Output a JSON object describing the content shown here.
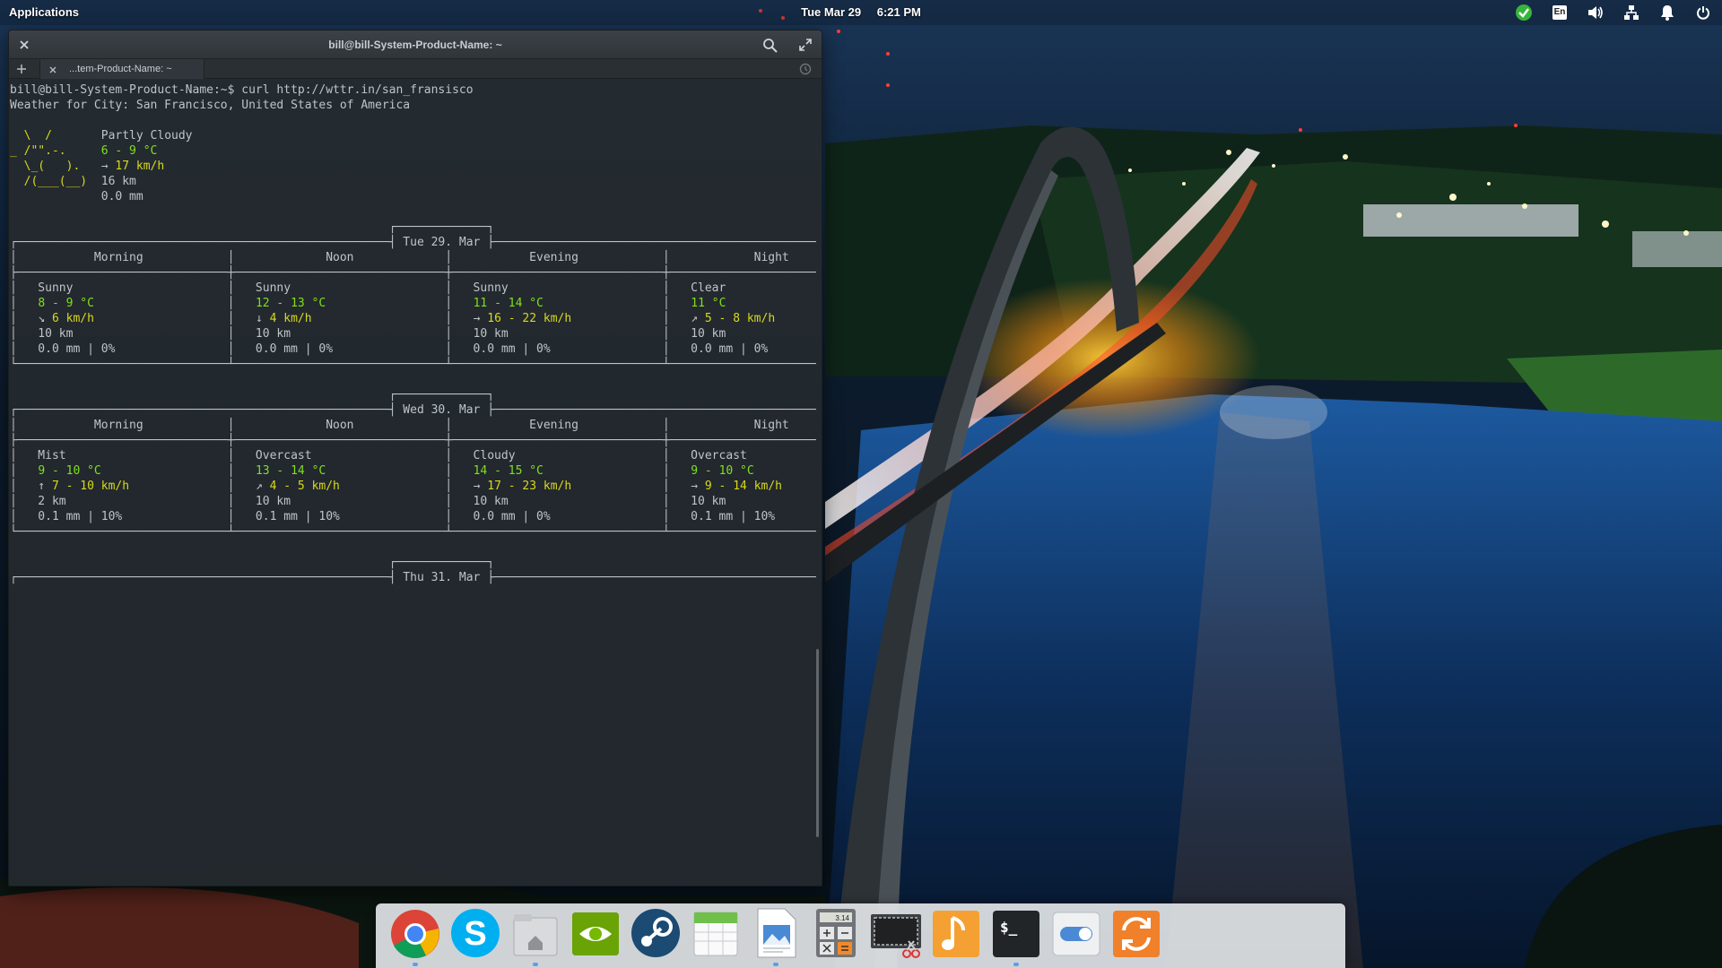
{
  "top_panel": {
    "applications_label": "Applications",
    "clock_date": "Tue Mar 29",
    "clock_time": "6:21 PM",
    "keyboard_layout": "En",
    "tray_icons": [
      "security-check-icon",
      "keyboard-layout-icon",
      "volume-icon",
      "network-icon",
      "notification-bell-icon",
      "power-icon"
    ]
  },
  "terminal": {
    "window_title": "bill@bill-System-Product-Name: ~",
    "tab_label": "...tem-Product-Name: ~",
    "colors": {
      "background": "#252a2e",
      "text": "#bfc4c8",
      "yellow": "#d8d81c",
      "green": "#7fe01a"
    },
    "prompt_line": "bill@bill-System-Product-Name:~$ curl http://wttr.in/san_fransisco",
    "location_line": "Weather for City: San Francisco, United States of America",
    "current": {
      "condition": "Partly Cloudy",
      "temperature": "6 - 9 °C",
      "wind": "→ 17 km/h",
      "visibility": "16 km",
      "precipitation": "0.0 mm"
    },
    "forecast": [
      {
        "date": "Tue 29. Mar",
        "columns": [
          "Morning",
          "Noon",
          "Evening",
          "Night"
        ],
        "periods": [
          {
            "condition": "Sunny",
            "temp": "8 - 9 °C",
            "wind": "↘ 6 km/h",
            "visibility": "10 km",
            "precip": "0.0 mm | 0%"
          },
          {
            "condition": "Sunny",
            "temp": "12 - 13 °C",
            "wind": "↓ 4 km/h",
            "visibility": "10 km",
            "precip": "0.0 mm | 0%"
          },
          {
            "condition": "Sunny",
            "temp": "11 - 14 °C",
            "wind": "→ 16 - 22 km/h",
            "visibility": "10 km",
            "precip": "0.0 mm | 0%"
          },
          {
            "condition": "Clear",
            "temp": "11 °C",
            "wind": "↗ 5 - 8 km/h",
            "visibility": "10 km",
            "precip": "0.0 mm | 0%"
          }
        ]
      },
      {
        "date": "Wed 30. Mar",
        "columns": [
          "Morning",
          "Noon",
          "Evening",
          "Night"
        ],
        "periods": [
          {
            "condition": "Mist",
            "temp": "9 - 10 °C",
            "wind": "↑ 7 - 10 km/h",
            "visibility": "2 km",
            "precip": "0.1 mm | 10%"
          },
          {
            "condition": "Overcast",
            "temp": "13 - 14 °C",
            "wind": "↗ 4 - 5 km/h",
            "visibility": "10 km",
            "precip": "0.1 mm | 10%"
          },
          {
            "condition": "Cloudy",
            "temp": "14 - 15 °C",
            "wind": "→ 17 - 23 km/h",
            "visibility": "10 km",
            "precip": "0.0 mm | 0%"
          },
          {
            "condition": "Overcast",
            "temp": "9 - 10 °C",
            "wind": "→ 9 - 14 km/h",
            "visibility": "10 km",
            "precip": "0.1 mm | 10%"
          }
        ]
      },
      {
        "date": "Thu 31. Mar"
      }
    ]
  },
  "dock": {
    "items": [
      {
        "name": "Chrome",
        "icon": "chrome-icon",
        "running": true
      },
      {
        "name": "Skype",
        "icon": "skype-icon",
        "running": false
      },
      {
        "name": "Files",
        "icon": "files-icon",
        "running": true
      },
      {
        "name": "NVIDIA Settings",
        "icon": "nvidia-icon",
        "running": false
      },
      {
        "name": "Steam",
        "icon": "steam-icon",
        "running": false
      },
      {
        "name": "Calendar",
        "icon": "calendar-icon",
        "running": false
      },
      {
        "name": "Document Viewer",
        "icon": "document-viewer-icon",
        "running": true
      },
      {
        "name": "Calculator",
        "icon": "calculator-icon",
        "running": false
      },
      {
        "name": "Screenshot",
        "icon": "screenshot-icon",
        "running": false
      },
      {
        "name": "Music",
        "icon": "music-icon",
        "running": false
      },
      {
        "name": "Terminal",
        "icon": "terminal-icon",
        "running": true
      },
      {
        "name": "System Settings",
        "icon": "settings-toggle-icon",
        "running": false
      },
      {
        "name": "Software Updater",
        "icon": "update-icon",
        "running": false
      }
    ],
    "calculator_display": "3.14"
  }
}
